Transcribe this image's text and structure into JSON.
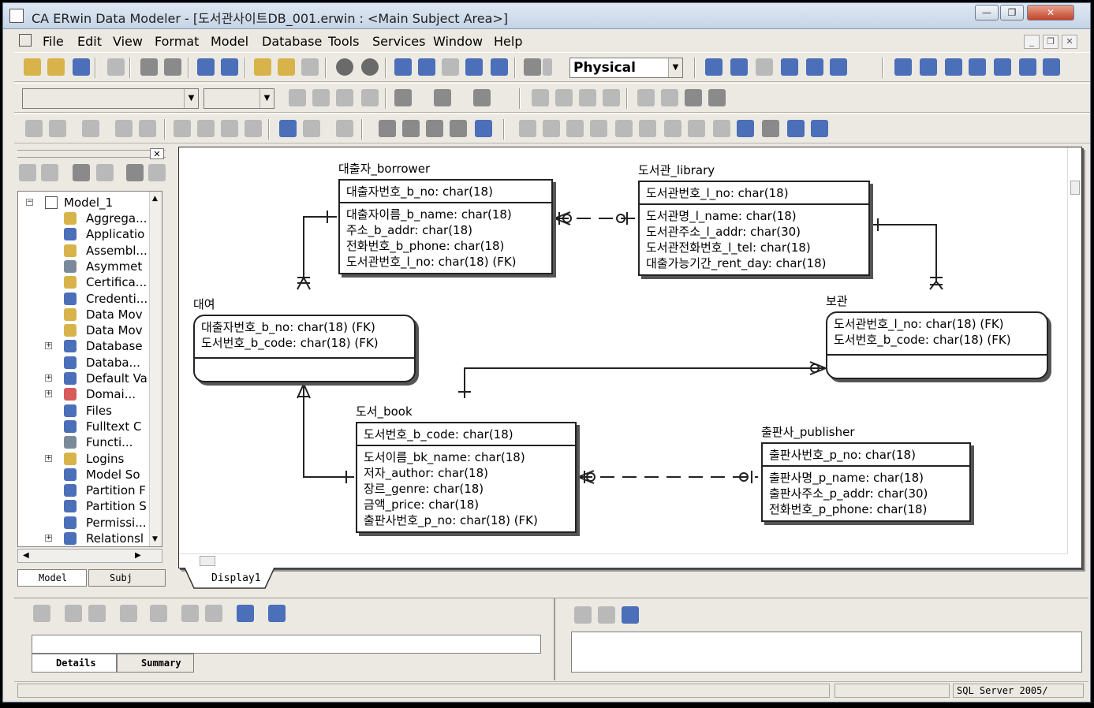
{
  "window": {
    "title": "CA ERwin Data Modeler - [도서관사이트DB_001.erwin : <Main Subject Area>]",
    "buttons": [
      "—",
      "❐",
      "✕"
    ]
  },
  "menu": [
    "File",
    "Edit",
    "View",
    "Format",
    "Model",
    "Database",
    "Tools",
    "Services",
    "Window",
    "Help"
  ],
  "toolbar": {
    "model_type": "Physical"
  },
  "tree": {
    "root": "Model_1",
    "items": [
      "Aggrega...",
      "Applicatio",
      "Assembl...",
      "Asymmet",
      "Certifica...",
      "Credenti...",
      "Data Mov",
      "Data Mov",
      "Database",
      "Databa...",
      "Default Va",
      "Domai...",
      "Files",
      "Fulltext C",
      "Functi...",
      "Logins",
      "Model So",
      "Partition F",
      "Partition S",
      "Permissi...",
      "Relationsl"
    ],
    "tab_model": "Model",
    "tab_subject": "Subj"
  },
  "diagram": {
    "display_tab": "Display1",
    "entities": {
      "borrower": {
        "name": "대출자_borrower",
        "pk": "대출자번호_b_no: char(18)",
        "attrs": [
          "대출자이름_b_name: char(18)",
          "주소_b_addr: char(18)",
          "전화번호_b_phone: char(18)",
          "도서관번호_l_no: char(18) (FK)"
        ]
      },
      "library": {
        "name": "도서관_library",
        "pk": "도서관번호_l_no: char(18)",
        "attrs": [
          "도서관명_l_name: char(18)",
          "도서관주소_l_addr: char(30)",
          "도서관전화번호_l_tel: char(18)",
          "대출가능기간_rent_day: char(18)"
        ]
      },
      "rental": {
        "name": "대여",
        "pk_lines": [
          "대출자번호_b_no: char(18) (FK)",
          "도서번호_b_code: char(18) (FK)"
        ]
      },
      "storage": {
        "name": "보관",
        "pk_lines": [
          "도서관번호_l_no: char(18) (FK)",
          "도서번호_b_code: char(18) (FK)"
        ]
      },
      "book": {
        "name": "도서_book",
        "pk": "도서번호_b_code: char(18)",
        "attrs": [
          "도서이름_bk_name: char(18)",
          "저자_author: char(18)",
          "장르_genre: char(18)",
          "금액_price: char(18)",
          "출판사번호_p_no: char(18) (FK)"
        ]
      },
      "publisher": {
        "name": "출판사_publisher",
        "pk": "출판사번호_p_no: char(18)",
        "attrs": [
          "출판사명_p_name: char(18)",
          "출판사주소_p_addr: char(30)",
          "전화번호_p_phone: char(18)"
        ]
      }
    }
  },
  "bottom": {
    "tab_details": "Details",
    "tab_summary": "Summary"
  },
  "status": {
    "db": "SQL Server 2005/"
  }
}
